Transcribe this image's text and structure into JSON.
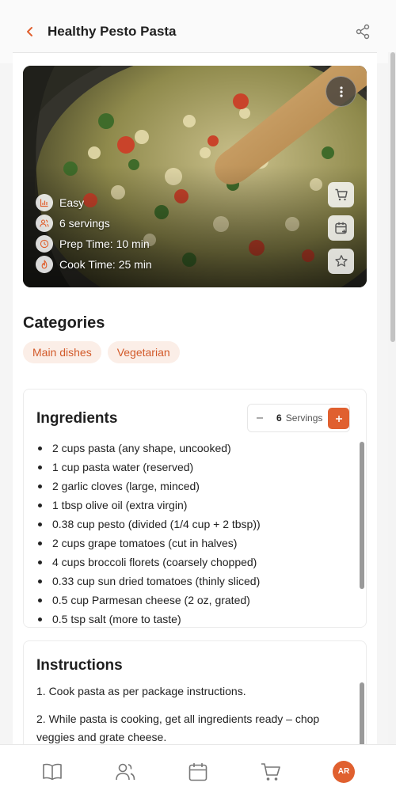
{
  "header": {
    "title": "Healthy Pesto Pasta"
  },
  "hero": {
    "meta": [
      {
        "icon": "bar-chart-icon",
        "text": "Easy"
      },
      {
        "icon": "users-icon",
        "text": "6 servings"
      },
      {
        "icon": "clock-icon",
        "text": "Prep Time: 10 min"
      },
      {
        "icon": "flame-icon",
        "text": "Cook Time: 25 min"
      }
    ],
    "side_actions": [
      "cart-icon",
      "calendar-add-icon",
      "star-icon"
    ]
  },
  "categories": {
    "title": "Categories",
    "items": [
      "Main dishes",
      "Vegetarian"
    ]
  },
  "ingredients": {
    "title": "Ingredients",
    "servings_count": "6",
    "servings_label": "Servings",
    "items": [
      "2 cups pasta (any shape, uncooked)",
      "1 cup pasta water (reserved)",
      "2 garlic cloves (large, minced)",
      "1 tbsp olive oil (extra virgin)",
      "0.38 cup pesto (divided (1/4 cup + 2 tbsp))",
      "2 cups grape tomatoes (cut in halves)",
      "4 cups broccoli florets (coarsely chopped)",
      "0.33 cup sun dried tomatoes (thinly sliced)",
      "0.5 cup Parmesan cheese (2 oz, grated)",
      "0.5 tsp salt (more to taste)"
    ]
  },
  "instructions": {
    "title": "Instructions",
    "steps": [
      "1. Cook pasta as per package instructions.",
      "2. While pasta is cooking, get all ingredients ready – chop veggies and grate cheese."
    ]
  },
  "bottom_nav": {
    "items": [
      "book-icon",
      "users-icon",
      "calendar-icon",
      "cart-icon"
    ],
    "avatar_initials": "AR"
  },
  "colors": {
    "accent": "#e0602f",
    "chip_bg": "#fbeee7",
    "chip_text": "#d25a2a"
  }
}
